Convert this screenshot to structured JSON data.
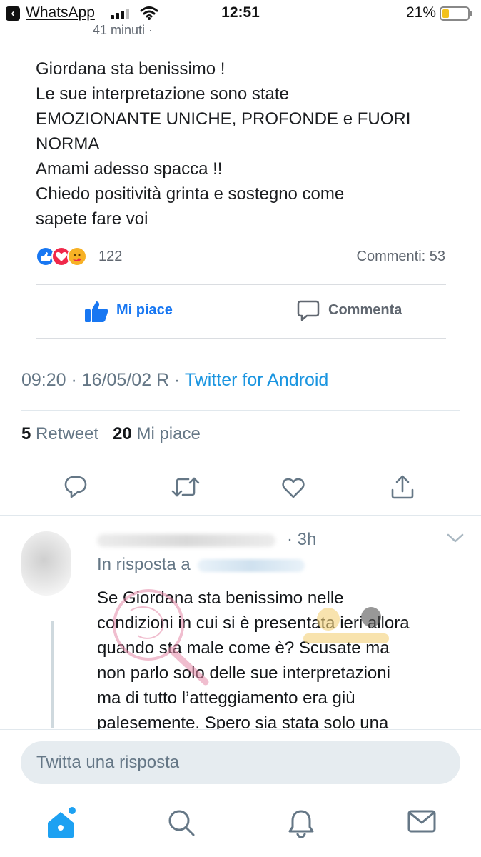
{
  "status_bar": {
    "back_app": "WhatsApp",
    "time": "12:51",
    "battery": "21%",
    "battery_level": 0.21,
    "icons": [
      "back-arrow-icon",
      "cellular-signal-icon",
      "wifi-icon",
      "battery-icon"
    ]
  },
  "fb_post": {
    "meta_cut": "41 minuti ·",
    "lines": [
      "Giordana sta benissimo !",
      "Le sue interpretazione sono state",
      "EMOZIONANTE  UNICHE, PROFONDE e FUORI",
      "NORMA",
      "Amami adesso spacca !!",
      "Chiedo positività grinta e sostegno come",
      "sapete fare voi"
    ],
    "reaction_count": "122",
    "comments": "Commenti: 53",
    "like_label": "Mi piace",
    "comment_label": "Commenta",
    "colors": {
      "like_blue": "#1877f2",
      "love_red": "#f0284a",
      "care_yellow": "#f7b125"
    }
  },
  "tweet": {
    "timestamp": "09:20 · 16/05/02 R · ",
    "source": "Twitter for Android",
    "retweet_count": "5",
    "retweet_label": "Retweet",
    "like_count": "20",
    "like_label": "Mi piace",
    "actions": [
      "reply-icon",
      "retweet-icon",
      "like-heart-icon",
      "share-icon"
    ]
  },
  "reply": {
    "time": "· 3h",
    "in_reply_to": "In risposta a",
    "lines": [
      "Se Giordana sta benissimo nelle",
      "condizioni in cui si è presentata ieri allora",
      "quando sta male come è? Scusate ma",
      "non parlo solo delle sue interpretazioni",
      "ma di tutto l’atteggiamento era giù",
      "palesemente. Spero sia stata solo una"
    ]
  },
  "compose": {
    "placeholder": "Twitta una risposta"
  },
  "bottom_nav": {
    "items": [
      "home-icon",
      "search-icon",
      "notifications-bell-icon",
      "messages-envelope-icon"
    ],
    "accent": "#1da1f2"
  }
}
